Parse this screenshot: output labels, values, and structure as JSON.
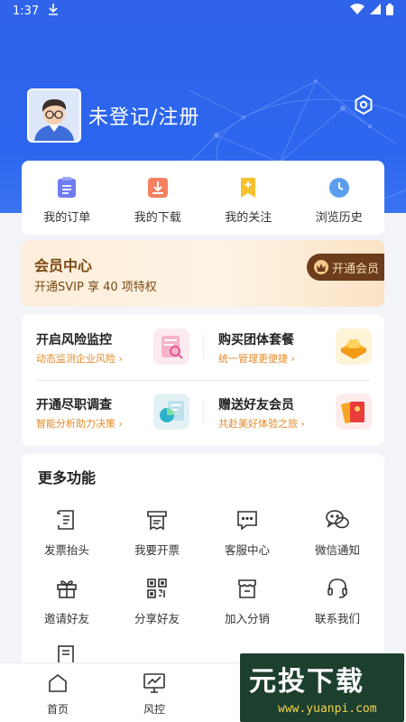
{
  "status_bar": {
    "time": "1:37"
  },
  "profile": {
    "login_label": "未登记/注册"
  },
  "quick_links": [
    {
      "label": "我的订单",
      "icon": "list-icon"
    },
    {
      "label": "我的下载",
      "icon": "download-icon"
    },
    {
      "label": "我的关注",
      "icon": "bookmark-icon"
    },
    {
      "label": "浏览历史",
      "icon": "clock-icon"
    }
  ],
  "vip": {
    "title": "会员中心",
    "subtitle": "开通SVIP 享 40 项特权",
    "button": "开通会员"
  },
  "promos": [
    {
      "title": "开启风险监控",
      "subtitle": "动态监测企业风险 ›"
    },
    {
      "title": "购买团体套餐",
      "subtitle": "统一管理更便捷 ›"
    },
    {
      "title": "开通尽职调查",
      "subtitle": "智能分析助力决策 ›"
    },
    {
      "title": "赠送好友会员",
      "subtitle": "共赴美好体验之旅 ›"
    }
  ],
  "more": {
    "title": "更多功能",
    "items": [
      {
        "label": "发票抬头",
        "icon": "receipt-icon"
      },
      {
        "label": "我要开票",
        "icon": "printer-icon"
      },
      {
        "label": "客服中心",
        "icon": "chat-icon"
      },
      {
        "label": "微信通知",
        "icon": "wechat-icon"
      },
      {
        "label": "邀请好友",
        "icon": "gift-icon"
      },
      {
        "label": "分享好友",
        "icon": "qrcode-icon"
      },
      {
        "label": "加入分销",
        "icon": "store-icon"
      },
      {
        "label": "联系我们",
        "icon": "headset-icon"
      }
    ]
  },
  "tabbar": [
    {
      "label": "首页",
      "icon": "home-icon"
    },
    {
      "label": "风控",
      "icon": "monitor-icon"
    }
  ],
  "watermark": {
    "main": "元投下载",
    "sub": "www.yuanpi.com"
  },
  "colors": {
    "primary": "#2c66ee",
    "vip_brown": "#6b3d1c",
    "accent_orange": "#e48a2b"
  }
}
